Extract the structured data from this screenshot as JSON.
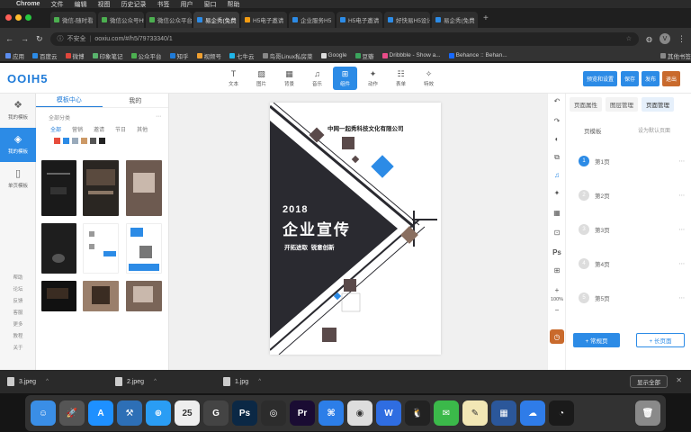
{
  "menubar": {
    "app": "Chrome",
    "items": [
      "文件",
      "编辑",
      "视图",
      "历史记录",
      "书签",
      "用户",
      "窗口",
      "帮助"
    ]
  },
  "tabs": [
    {
      "label": "微信-随时看",
      "color": "#4caf50"
    },
    {
      "label": "微信公众号H5",
      "color": "#4caf50"
    },
    {
      "label": "微信公众平台",
      "color": "#4caf50"
    },
    {
      "label": "易企秀(免费",
      "color": "#2c8be6"
    },
    {
      "label": "H5电子邀请",
      "color": "#f39c12"
    },
    {
      "label": "企业服务H5",
      "color": "#2c8be6"
    },
    {
      "label": "H5电子邀请",
      "color": "#2c8be6"
    },
    {
      "label": "好快易H5设计",
      "color": "#2c8be6"
    },
    {
      "label": "易企秀(免费",
      "color": "#2c8be6"
    }
  ],
  "address": {
    "security": "不安全",
    "url": "ooxiu.com/#/h5/79733340/1",
    "profile_initial": "V"
  },
  "bookmarks": [
    {
      "label": "应用",
      "color": "#5b8def"
    },
    {
      "label": "百度云",
      "color": "#2c8be6"
    },
    {
      "label": "微博",
      "color": "#e0473c"
    },
    {
      "label": "印象笔记",
      "color": "#59b36c"
    },
    {
      "label": "公众平台",
      "color": "#4caf50"
    },
    {
      "label": "知乎",
      "color": "#1f7bd8"
    },
    {
      "label": "视频号",
      "color": "#f0a030"
    },
    {
      "label": "七牛云",
      "color": "#1fb5e8"
    },
    {
      "label": "鸟哥Linux私房菜",
      "color": "#888888"
    },
    {
      "label": "Google",
      "color": "#dddddd"
    },
    {
      "label": "豆瓣",
      "color": "#3ba55d"
    },
    {
      "label": "Dribbble - Show a...",
      "color": "#ea4c89"
    },
    {
      "label": "Behance :: Behan...",
      "color": "#1769ff"
    },
    {
      "label": "其他书签",
      "color": "#888888"
    }
  ],
  "editor": {
    "logo": "OOIH5",
    "tools": [
      {
        "label": "文本",
        "icon": "T"
      },
      {
        "label": "图片",
        "icon": "▨"
      },
      {
        "label": "背景",
        "icon": "▦"
      },
      {
        "label": "音乐",
        "icon": "♫"
      },
      {
        "label": "组件",
        "icon": "⊞"
      },
      {
        "label": "动作",
        "icon": "✦"
      },
      {
        "label": "表单",
        "icon": "☷"
      },
      {
        "label": "特效",
        "icon": "✧"
      }
    ],
    "active_tool": 4,
    "buttons": {
      "preview": "预览和设置",
      "save": "保存",
      "publish": "发布",
      "exit": "退出"
    }
  },
  "left_nav": {
    "items": [
      {
        "label": "我的模板",
        "icon": "❖"
      },
      {
        "label": "我的模板",
        "icon": "◈"
      },
      {
        "label": "单页模板",
        "icon": "▯"
      }
    ],
    "active": 1,
    "bottom_links": [
      "帮助",
      "论坛",
      "反馈",
      "客服",
      "更多",
      "教程",
      "关于"
    ]
  },
  "template_panel": {
    "tabs": [
      "模板中心",
      "我的"
    ],
    "active_tab": 0,
    "filter_text": "全部分类",
    "categories": [
      "全部",
      "营销",
      "邀请",
      "节日",
      "其他"
    ],
    "active_category": 0
  },
  "poster": {
    "company": "中网一起秀科技文化有限公司",
    "year": "2018",
    "title": "企业宣传",
    "slogan": "开拓进取  锐意创新"
  },
  "right_panel": {
    "tabs": [
      "页面属性",
      "图层管理",
      "页面管理"
    ],
    "active_tab": 2,
    "header_left": "页模板",
    "header_right": "设为默认页面",
    "pages": [
      "第1页",
      "第2页",
      "第3页",
      "第4页",
      "第5页"
    ],
    "active_page": 0,
    "zoom": "100%",
    "add_button": "+ 常规页",
    "add_long_button": "+ 长页面"
  },
  "right_toolbar": {
    "undo": "↶",
    "redo": "↷"
  },
  "downloads": {
    "files": [
      "3.jpeg",
      "2.jpeg",
      "1.jpg"
    ],
    "show_all": "显示全部"
  },
  "dock": {
    "apps": [
      {
        "name": "finder",
        "color": "#3a8ee6",
        "glyph": "☺"
      },
      {
        "name": "launchpad",
        "color": "#555555",
        "glyph": "🚀"
      },
      {
        "name": "app-store",
        "color": "#1e90ff",
        "glyph": "A"
      },
      {
        "name": "xcode",
        "color": "#2d6fb6",
        "glyph": "⚒"
      },
      {
        "name": "safari",
        "color": "#2a9df4",
        "glyph": "⊕"
      },
      {
        "name": "calendar",
        "color": "#eeeeee",
        "glyph": "25"
      },
      {
        "name": "gravit",
        "color": "#444444",
        "glyph": "G"
      },
      {
        "name": "photoshop",
        "color": "#0b2845",
        "glyph": "Ps"
      },
      {
        "name": "illustrator-alt",
        "color": "#2c2c2c",
        "glyph": "◎"
      },
      {
        "name": "premiere",
        "color": "#1a0c33",
        "glyph": "Pr"
      },
      {
        "name": "keynote",
        "color": "#2c7ee8",
        "glyph": "⌘"
      },
      {
        "name": "chrome",
        "color": "#dddddd",
        "glyph": "◉"
      },
      {
        "name": "wps",
        "color": "#2f6de1",
        "glyph": "W"
      },
      {
        "name": "qq",
        "color": "#222222",
        "glyph": "🐧"
      },
      {
        "name": "wechat",
        "color": "#3bb94a",
        "glyph": "✉"
      },
      {
        "name": "notes",
        "color": "#f2e7b5",
        "glyph": "✎"
      },
      {
        "name": "word",
        "color": "#2b579a",
        "glyph": "▦"
      },
      {
        "name": "baidu-netdisk",
        "color": "#2f7ce8",
        "glyph": "☁"
      },
      {
        "name": "quicktime",
        "color": "#1a1a1a",
        "glyph": "◔"
      },
      {
        "name": "trash",
        "color": "#8a8a8a",
        "glyph": "🗑"
      }
    ]
  }
}
